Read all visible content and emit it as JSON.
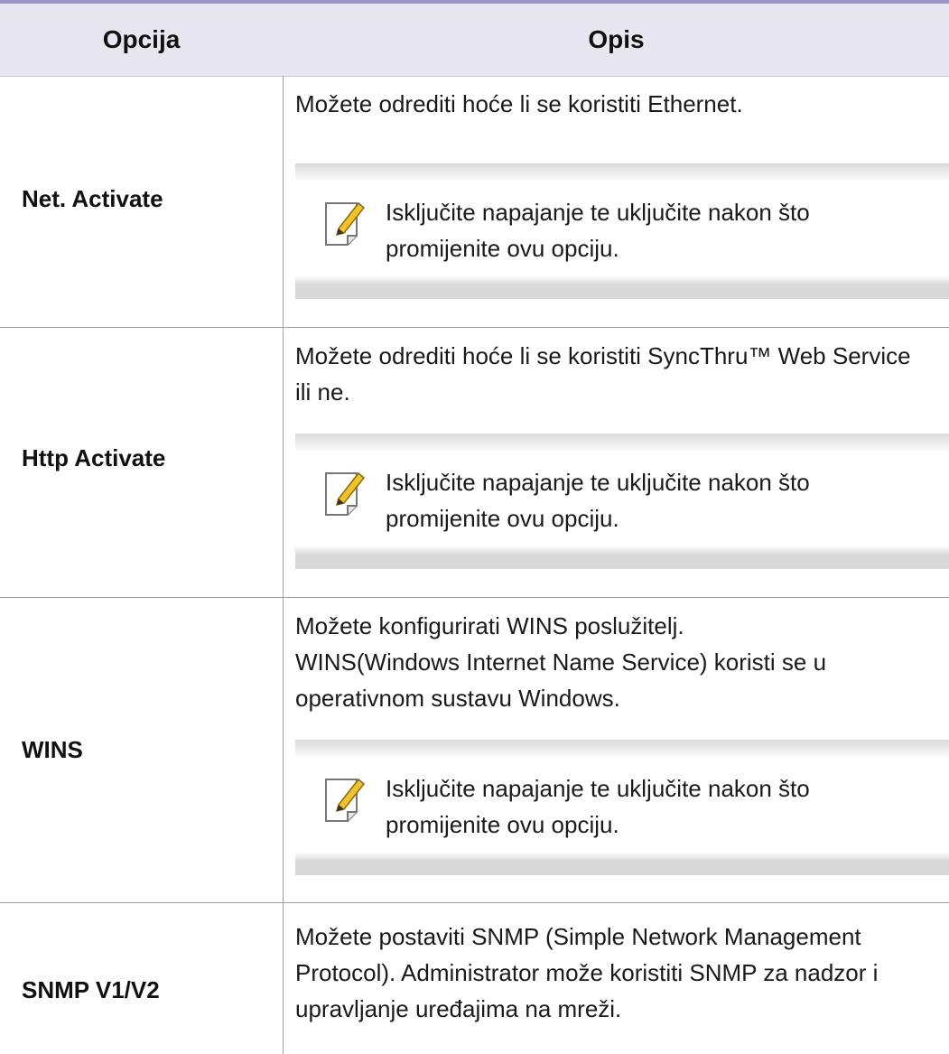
{
  "header": {
    "col_option": "Opcija",
    "col_desc": "Opis"
  },
  "rows": [
    {
      "option": "Net. Activate",
      "desc": "Možete odrediti hoće li se koristiti Ethernet.",
      "note": "Isključite napajanje te uključite nakon što promijenite ovu opciju."
    },
    {
      "option": "Http Activate",
      "desc": "Možete odrediti hoće li se koristiti SyncThru™ Web Service ili ne.",
      "note": "Isključite napajanje te uključite nakon što promijenite ovu opciju."
    },
    {
      "option": "WINS",
      "desc_lines": [
        "Možete konfigurirati WINS poslužitelj.",
        "WINS(Windows Internet Name Service) koristi se u operativnom sustavu Windows."
      ],
      "note": "Isključite napajanje te uključite nakon što promijenite ovu opciju."
    },
    {
      "option": "SNMP V1/V2",
      "desc": "Možete postaviti SNMP (Simple Network Management Protocol). Administrator može koristiti SNMP za nadzor i upravljanje uređajima na mreži."
    }
  ],
  "icons": {
    "note": "note-pencil-icon"
  },
  "colors": {
    "header_bg": "#e8e7f1",
    "top_rule": "#9a94c4",
    "note_band": "#d9d9d9",
    "pencil": "#f2c12e"
  }
}
